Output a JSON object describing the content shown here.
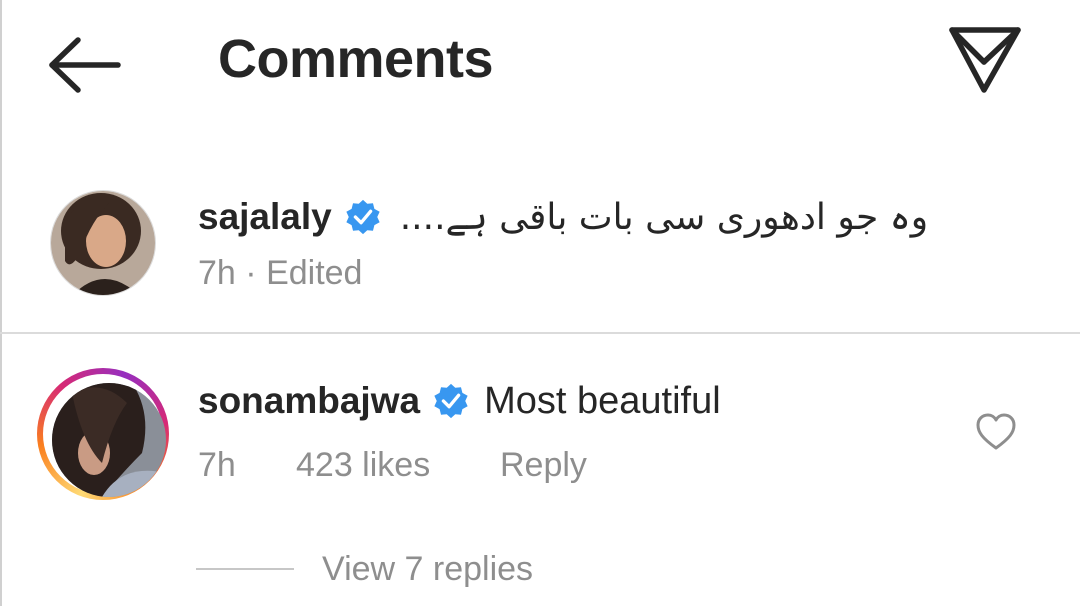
{
  "header": {
    "title": "Comments",
    "back_icon": "arrow-left-icon",
    "share_icon": "paper-plane-icon"
  },
  "caption": {
    "username": "sajalaly",
    "verified": true,
    "text": "وہ جو ادھوری سی بات باقی ہے....",
    "time": "7h",
    "separator": "·",
    "edited_label": "Edited"
  },
  "comments": [
    {
      "username": "sonambajwa",
      "verified": true,
      "text": "Most beautiful",
      "time": "7h",
      "likes": "423 likes",
      "reply_label": "Reply",
      "view_replies": "View 7 replies"
    }
  ],
  "colors": {
    "text": "#262626",
    "secondary": "#8e8e8e",
    "verified_blue": "#3897f0",
    "divider": "#dbdbdb"
  }
}
